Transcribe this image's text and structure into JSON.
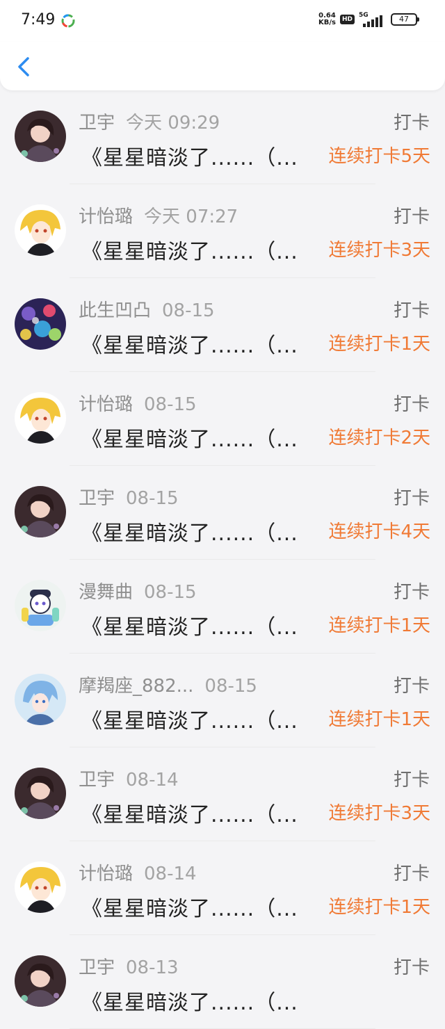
{
  "status_bar": {
    "time": "7:49",
    "net_speed_value": "0.64",
    "net_speed_unit": "KB/s",
    "hd": "HD",
    "network": "5G",
    "battery": "47"
  },
  "nav": {
    "back_icon": "chevron-left-icon"
  },
  "colors": {
    "streak": "#f07a35",
    "back": "#2d8cf0"
  },
  "entries": [
    {
      "name": "卫宇",
      "date": "今天 09:29",
      "title": "《星星暗淡了......（...",
      "type": "打卡",
      "streak": "连续打卡5天",
      "avatar": "woman"
    },
    {
      "name": "计怡璐",
      "date": "今天 07:27",
      "title": "《星星暗淡了......（...",
      "type": "打卡",
      "streak": "连续打卡3天",
      "avatar": "anime-blond"
    },
    {
      "name": "此生凹凸",
      "date": "08-15",
      "title": "《星星暗淡了......（...",
      "type": "打卡",
      "streak": "连续打卡1天",
      "avatar": "collage"
    },
    {
      "name": "计怡璐",
      "date": "08-15",
      "title": "《星星暗淡了......（...",
      "type": "打卡",
      "streak": "连续打卡2天",
      "avatar": "anime-blond"
    },
    {
      "name": "卫宇",
      "date": "08-15",
      "title": "《星星暗淡了......（...",
      "type": "打卡",
      "streak": "连续打卡4天",
      "avatar": "woman"
    },
    {
      "name": "漫舞曲",
      "date": "08-15",
      "title": "《星星暗淡了......（...",
      "type": "打卡",
      "streak": "连续打卡1天",
      "avatar": "cartoon"
    },
    {
      "name": "摩羯座_882...",
      "date": "08-15",
      "title": "《星星暗淡了......（...",
      "type": "打卡",
      "streak": "连续打卡1天",
      "avatar": "anime-blue"
    },
    {
      "name": "卫宇",
      "date": "08-14",
      "title": "《星星暗淡了......（...",
      "type": "打卡",
      "streak": "连续打卡3天",
      "avatar": "woman"
    },
    {
      "name": "计怡璐",
      "date": "08-14",
      "title": "《星星暗淡了......（...",
      "type": "打卡",
      "streak": "连续打卡1天",
      "avatar": "anime-blond"
    },
    {
      "name": "卫宇",
      "date": "08-13",
      "title": "《星星暗淡了......（...",
      "type": "打卡",
      "streak": "",
      "avatar": "woman"
    }
  ]
}
